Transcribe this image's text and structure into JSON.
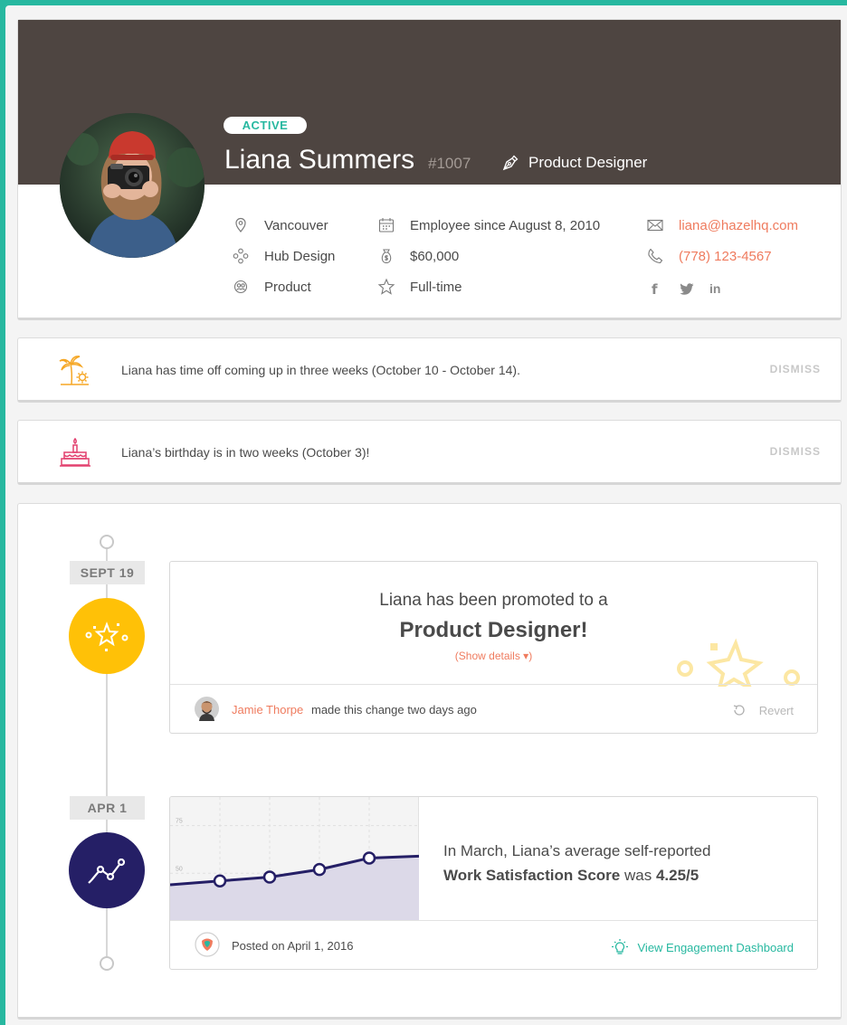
{
  "profile": {
    "status": "ACTIVE",
    "name": "Liana Summers",
    "employee_id": "#1007",
    "role": "Product Designer",
    "location": "Vancouver",
    "team": "Hub Design",
    "department": "Product",
    "employee_since": "Employee since August 8, 2010",
    "salary": "$60,000",
    "employment_type": "Full-time",
    "email": "liana@hazelhq.com",
    "phone": "(778) 123-4567",
    "social": {
      "facebook": "f",
      "twitter": "twitter-icon",
      "linkedin": "in"
    },
    "colors": {
      "header": "#4e4541",
      "accent": "#27b8a0",
      "link": "#ef7b5e"
    }
  },
  "notices": [
    {
      "icon": "palm-tree-icon",
      "text": "Liana has time off coming up in three weeks (October 10 - October 14).",
      "action": "DISMISS"
    },
    {
      "icon": "birthday-cake-icon",
      "text": "Liana’s birthday is in two weeks (October 3)!",
      "action": "DISMISS"
    }
  ],
  "timeline": {
    "events": [
      {
        "date": "SEPT 19",
        "icon": "star-sparkle-icon",
        "line1": "Liana has been promoted to a",
        "line2": "Product Designer!",
        "details": "(Show details ▾)",
        "author": "Jamie Thorpe",
        "meta": "made this change two days ago",
        "action": "Revert"
      },
      {
        "date": "APR 1",
        "icon": "line-chart-icon",
        "line1": "In March, Liana’s average self-reported",
        "metric_label": "Work Satisfaction Score",
        "metric_mid": "was",
        "metric_value": "4.25/5",
        "posted": "Posted on April 1, 2016",
        "action": "View Engagement Dashboard"
      }
    ]
  },
  "chart_data": {
    "type": "area",
    "y_ticks": [
      "75",
      "50"
    ],
    "ylim": [
      25,
      90
    ],
    "points": [
      44,
      46,
      48,
      52,
      58,
      59
    ],
    "marked_points": [
      1,
      2,
      3,
      4
    ],
    "grid": true
  }
}
